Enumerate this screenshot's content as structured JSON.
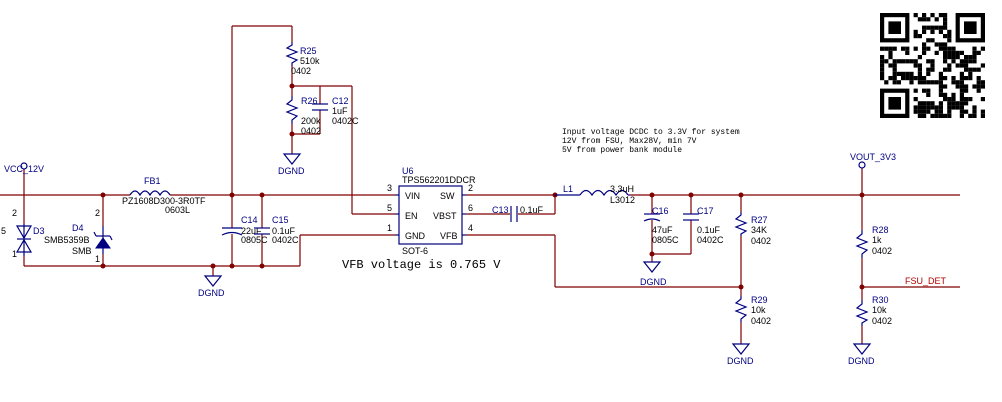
{
  "nets": {
    "vcc": "VCC_12V",
    "vout": "VOUT_3V3",
    "fsu_det": "FSU_DET",
    "gnd": "DGND"
  },
  "d5_fragment": "5",
  "d3": {
    "ref": "D3",
    "pin1": "1",
    "pin2": "2"
  },
  "d4": {
    "ref": "D4",
    "part": "SMB5359B",
    "pkg": "SMB",
    "pin1": "1",
    "pin2": "2"
  },
  "fb1": {
    "ref": "FB1",
    "part": "PZ1608D300-3R0TF",
    "pkg": "0603L"
  },
  "c14": {
    "ref": "C14",
    "value": "22uF",
    "pkg": "0805C"
  },
  "c15": {
    "ref": "C15",
    "value": "0.1uF",
    "pkg": "0402C"
  },
  "r25": {
    "ref": "R25",
    "value": "510k",
    "pkg": "0402"
  },
  "r26": {
    "ref": "R26",
    "value": "200k",
    "pkg": "0402"
  },
  "c12": {
    "ref": "C12",
    "value": "1uF",
    "pkg": "0402C"
  },
  "u6": {
    "ref": "U6",
    "part": "TPS562201DDCR",
    "pkg": "SOT-6",
    "pins": {
      "vin": "VIN",
      "en": "EN",
      "gnd": "GND",
      "sw": "SW",
      "vbst": "VBST",
      "vfb": "VFB",
      "n1": "1",
      "n2": "2",
      "n3": "3",
      "n4": "4",
      "n5": "5",
      "n6": "6"
    }
  },
  "c13": {
    "ref": "C13",
    "value": "0.1uF"
  },
  "l1": {
    "ref": "L1",
    "value": "3.3uH",
    "pkg": "L3012"
  },
  "c16": {
    "ref": "C16",
    "value": "47uF",
    "pkg": "0805C"
  },
  "c17": {
    "ref": "C17",
    "value": "0.1uF",
    "pkg": "0402C"
  },
  "r27": {
    "ref": "R27",
    "value": "34K",
    "pkg": "0402"
  },
  "r28": {
    "ref": "R28",
    "value": "1k",
    "pkg": "0402"
  },
  "r29": {
    "ref": "R29",
    "value": "10k",
    "pkg": "0402"
  },
  "r30": {
    "ref": "R30",
    "value": "10k",
    "pkg": "0402"
  },
  "note": [
    "Input voltage DCDC to 3.3V for system",
    "12V from FSU, Max28V, min 7V",
    "5V from power bank module"
  ],
  "vfb_note": "VFB voltage is 0.765 V"
}
